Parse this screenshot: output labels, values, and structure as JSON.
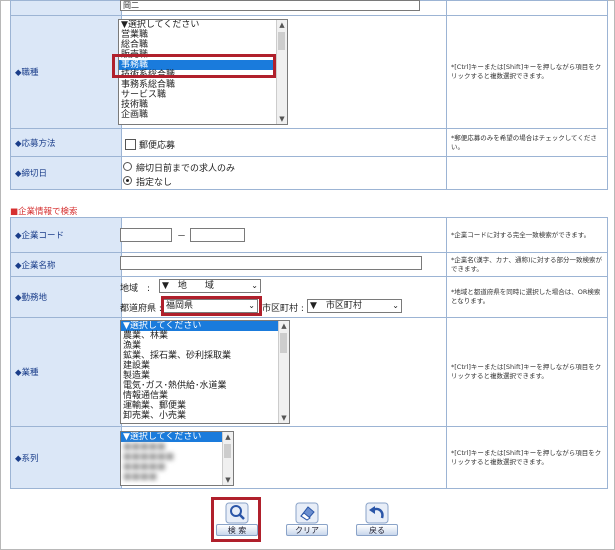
{
  "top_field": {
    "value": "岡二"
  },
  "job_type": {
    "label": "◆職種",
    "options": [
      "▼選択してください",
      "営業職",
      "総合職",
      "販売職",
      "事務職",
      "技術系総合職",
      "事務系総合職",
      "サービス職",
      "技術職",
      "企画職"
    ],
    "selected_index": 4,
    "note": "*[Ctrl]キーまたは[Shift]キーを押しながら項目をクリックすると複数選択できます。"
  },
  "apply_method": {
    "label": "◆応募方法",
    "checkbox_label": "郵便応募",
    "note": "*郵便応募のみを希望の場合はチェックしてください。"
  },
  "deadline": {
    "label": "◆締切日",
    "options": [
      "締切日前までの求人のみ",
      "指定なし"
    ],
    "selected_index": 1
  },
  "company_section": {
    "title": "■企業情報で検索"
  },
  "company_code": {
    "label": "◆企業コード",
    "separator": "－",
    "note": "*企業コードに対する完全一致検索ができます。"
  },
  "company_name": {
    "label": "◆企業名称",
    "note": "*企業名(漢字、カナ、通称)に対する部分一致検索ができます。"
  },
  "location": {
    "label": "◆勤務地",
    "region_label": "地域　:",
    "region_value": "▼　地　　域",
    "pref_label": "都道府県 :",
    "pref_value": "福岡県",
    "city_label": "市区町村 :",
    "city_value": "▼　市区町村",
    "note": "*地域と都道府県を同時に選択した場合は、OR検索となります。"
  },
  "industry": {
    "label": "◆業種",
    "options": [
      "▼選択してください",
      "農業、林業",
      "漁業",
      "鉱業、採石業、砂利採取業",
      "建設業",
      "製造業",
      "電気･ガス･熱供給･水道業",
      "情報通信業",
      "運輸業、郵便業",
      "卸売業、小売業"
    ],
    "selected_index": 0,
    "note": "*[Ctrl]キーまたは[Shift]キーを押しながら項目をクリックすると複数選択できます。"
  },
  "group": {
    "label": "◆系列",
    "options": [
      "▼選択してください",
      "■■■■■",
      "■■■■■■",
      "■■■■■",
      "■■■■"
    ],
    "selected_index": 0,
    "note": "*[Ctrl]キーまたは[Shift]キーを押しながら項目をクリックすると複数選択できます。"
  },
  "buttons": {
    "search": "検 索",
    "clear": "クリア",
    "back": "戻る"
  },
  "colors": {
    "highlight": "#b0202c",
    "selection": "#1a7bdc",
    "label_bg": "#dbe7f7",
    "section": "#d63030"
  }
}
